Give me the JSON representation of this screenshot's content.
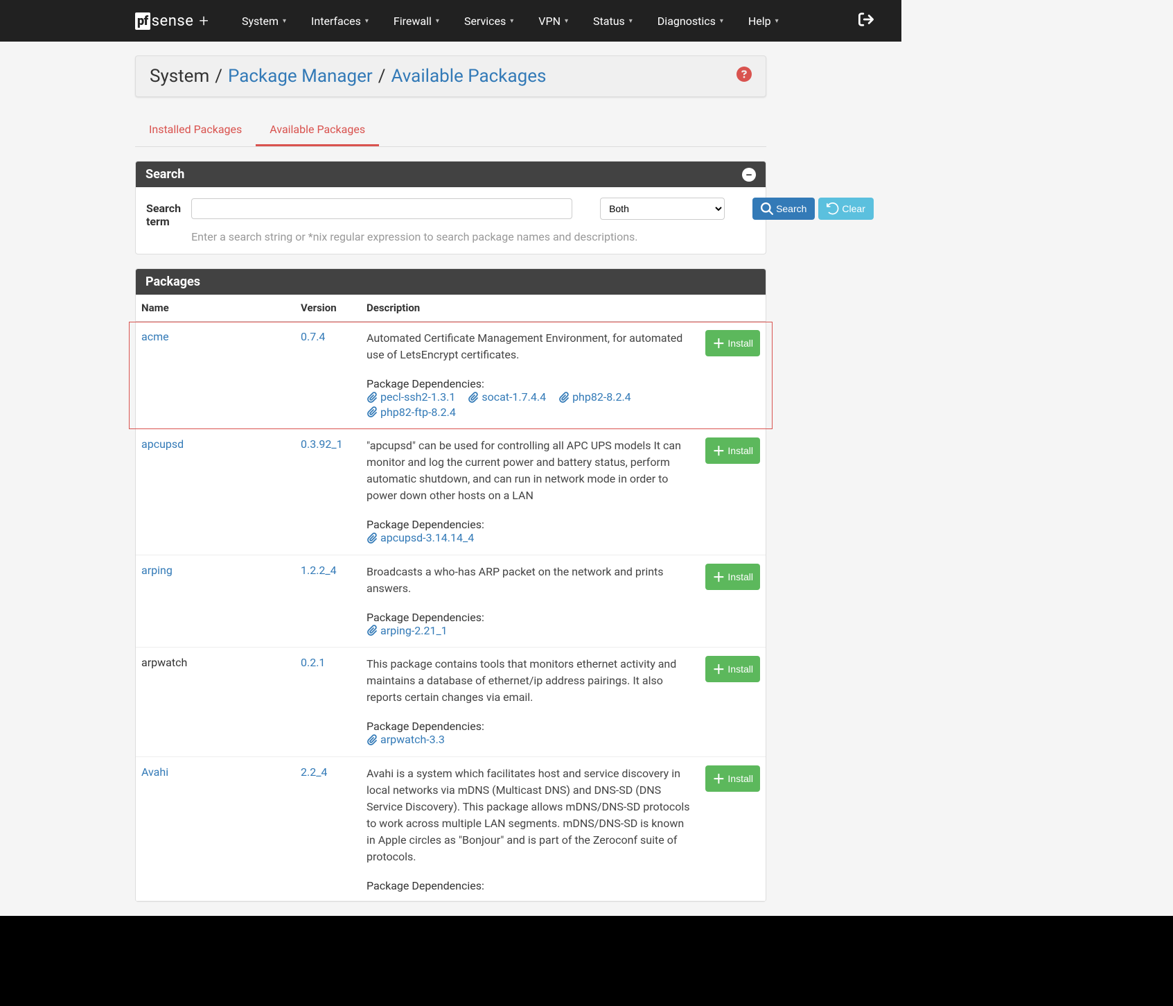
{
  "nav": {
    "items": [
      "System",
      "Interfaces",
      "Firewall",
      "Services",
      "VPN",
      "Status",
      "Diagnostics",
      "Help"
    ]
  },
  "breadcrumb": {
    "root": "System",
    "l1": "Package Manager",
    "l2": "Available Packages"
  },
  "tabs": {
    "installed": "Installed Packages",
    "available": "Available Packages"
  },
  "search": {
    "panel_title": "Search",
    "label": "Search term",
    "select_value": "Both",
    "search_btn": "Search",
    "clear_btn": "Clear",
    "help": "Enter a search string or *nix regular expression to search package names and descriptions."
  },
  "packages": {
    "panel_title": "Packages",
    "headers": {
      "name": "Name",
      "version": "Version",
      "description": "Description"
    },
    "install_label": "Install",
    "deps_label": "Package Dependencies:",
    "rows": [
      {
        "name": "acme",
        "name_link": true,
        "version": "0.7.4",
        "desc": "Automated Certificate Management Environment, for automated use of LetsEncrypt certificates.",
        "deps": [
          "pecl-ssh2-1.3.1",
          "socat-1.7.4.4",
          "php82-8.2.4",
          "php82-ftp-8.2.4"
        ],
        "highlight": true
      },
      {
        "name": "apcupsd",
        "name_link": true,
        "version": "0.3.92_1",
        "desc": "\"apcupsd\" can be used for controlling all APC UPS models It can monitor and log the current power and battery status, perform automatic shutdown, and can run in network mode in order to power down other hosts on a LAN",
        "deps": [
          "apcupsd-3.14.14_4"
        ]
      },
      {
        "name": "arping",
        "name_link": true,
        "version": "1.2.2_4",
        "desc": "Broadcasts a who-has ARP packet on the network and prints answers.",
        "deps": [
          "arping-2.21_1"
        ]
      },
      {
        "name": "arpwatch",
        "name_link": false,
        "version": "0.2.1",
        "desc": "This package contains tools that monitors ethernet activity and maintains a database of ethernet/ip address pairings. It also reports certain changes via email.",
        "deps": [
          "arpwatch-3.3"
        ]
      },
      {
        "name": "Avahi",
        "name_link": true,
        "version": "2.2_4",
        "desc": "Avahi is a system which facilitates host and service discovery in local networks via mDNS (Multicast DNS) and DNS-SD (DNS Service Discovery). This package allows mDNS/DNS-SD protocols to work across multiple LAN segments. mDNS/DNS-SD is known in Apple circles as \"Bonjour\" and is part of the Zeroconf suite of protocols.",
        "deps": []
      }
    ]
  }
}
